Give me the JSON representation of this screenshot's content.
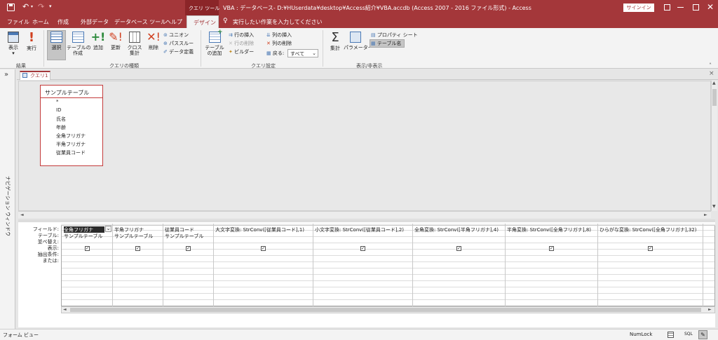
{
  "title_bar": {
    "tool_context": "クエリ ツール",
    "window_title": "VBA : データベース- D:¥HUserdata¥desktop¥Access紹介¥VBA.accdb (Access 2007 - 2016 ファイル形式) - Access",
    "signin_label": "サインイン"
  },
  "tabs": {
    "file": "ファイル",
    "home": "ホーム",
    "create": "作成",
    "external": "外部データ",
    "dbtools": "データベース ツール",
    "help": "ヘルプ",
    "design": "デザイン",
    "tell_me": "実行したい作業を入力してください"
  },
  "ribbon": {
    "view": "表示",
    "run": "実行",
    "select": "選択",
    "make_table": "テーブルの\n作成",
    "append": "追加",
    "update": "更新",
    "crosstab": "クロス\n集計",
    "delete": "削除",
    "union": "ユニオン",
    "passthrough": "パススルー",
    "data_definition": "データ定義",
    "show_table": "テーブル\nの追加",
    "insert_rows": "行の挿入",
    "delete_rows": "行の削除",
    "builder": "ビルダー",
    "insert_cols": "列の挿入",
    "delete_cols": "列の削除",
    "return_label": "戻る:",
    "return_value": "すべて",
    "totals": "集計",
    "parameters": "パラメーター",
    "property_sheet": "プロパティ シート",
    "table_names": "テーブル名",
    "groups": {
      "results": "結果",
      "query_type": "クエリの種類",
      "query_setup": "クエリ設定",
      "show_hide": "表示/非表示"
    }
  },
  "nav_pane": {
    "label": "ナビゲーション ウィンドウ",
    "toggle": "»"
  },
  "object_tab": {
    "label": "クエリ1",
    "close": "×"
  },
  "table_box": {
    "title": "サンプルテーブル",
    "fields": [
      "*",
      "ID",
      "氏名",
      "年齢",
      "全角フリガナ",
      "半角フリガナ",
      "従業員コード"
    ]
  },
  "grid": {
    "row_labels": [
      "フィールド:",
      "テーブル:",
      "並べ替え:",
      "表示:",
      "抽出条件:",
      "または:"
    ],
    "columns": [
      {
        "field": "全角フリガナ",
        "table": "サンプルテーブル",
        "show": true
      },
      {
        "field": "半角フリガナ",
        "table": "サンプルテーブル",
        "show": true
      },
      {
        "field": "従業員コード",
        "table": "サンプルテーブル",
        "show": true
      },
      {
        "field": "大文字変換: StrConv([従業員コード],1)",
        "table": "",
        "show": true
      },
      {
        "field": "小文字変換: StrConv([従業員コード],2)",
        "table": "",
        "show": true
      },
      {
        "field": "全角変換: StrConv([半角フリガナ],4)",
        "table": "",
        "show": true
      },
      {
        "field": "半角変換: StrConv([全角フリガナ],8)",
        "table": "",
        "show": true
      },
      {
        "field": "ひらがな変換: StrConv([全角フリガナ],32)",
        "table": "",
        "show": true
      }
    ]
  },
  "status_bar": {
    "view_name": "フォーム ビュー",
    "numlock": "NumLock",
    "sql": "SQL"
  },
  "colors": {
    "accent": "#a4373a",
    "ribbon_bg": "#f3f3f3",
    "table_border": "#c43b3b"
  }
}
